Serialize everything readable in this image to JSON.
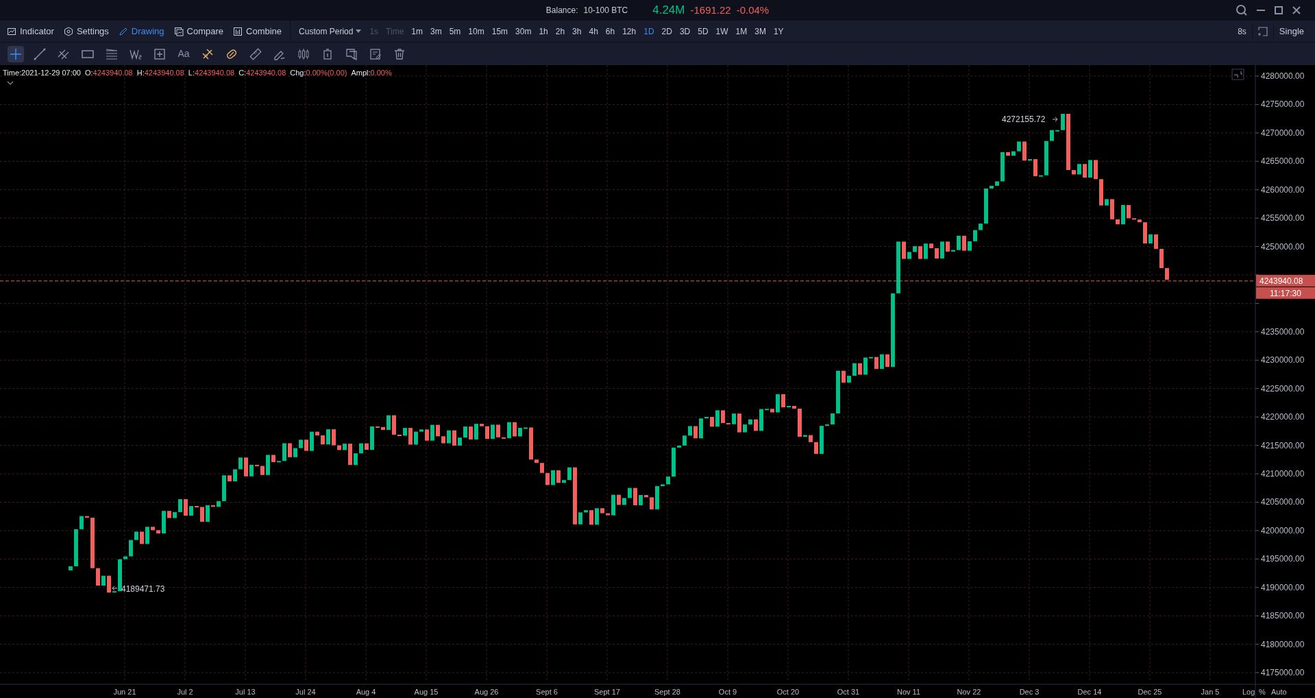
{
  "title_bar": {
    "balance_label": "Balance:",
    "balance_range": "10-100 BTC",
    "price": "4.24M",
    "change": "-1691.22",
    "change_pct": "-0.04%"
  },
  "menu": [
    {
      "label": "Indicator",
      "selected": false
    },
    {
      "label": "Settings",
      "selected": false
    },
    {
      "label": "Drawing",
      "selected": true
    },
    {
      "label": "Compare",
      "selected": false
    },
    {
      "label": "Combine",
      "selected": false
    }
  ],
  "period_dropdown": "Custom Period",
  "periods": [
    {
      "label": "1s",
      "disabled": true,
      "selected": false
    },
    {
      "label": "Time",
      "disabled": true,
      "selected": false
    },
    {
      "label": "1m",
      "disabled": false,
      "selected": false
    },
    {
      "label": "3m",
      "disabled": false,
      "selected": false
    },
    {
      "label": "5m",
      "disabled": false,
      "selected": false
    },
    {
      "label": "10m",
      "disabled": false,
      "selected": false
    },
    {
      "label": "15m",
      "disabled": false,
      "selected": false
    },
    {
      "label": "30m",
      "disabled": false,
      "selected": false
    },
    {
      "label": "1h",
      "disabled": false,
      "selected": false
    },
    {
      "label": "2h",
      "disabled": false,
      "selected": false
    },
    {
      "label": "3h",
      "disabled": false,
      "selected": false
    },
    {
      "label": "4h",
      "disabled": false,
      "selected": false
    },
    {
      "label": "6h",
      "disabled": false,
      "selected": false
    },
    {
      "label": "12h",
      "disabled": false,
      "selected": false
    },
    {
      "label": "1D",
      "disabled": false,
      "selected": true
    },
    {
      "label": "2D",
      "disabled": false,
      "selected": false
    },
    {
      "label": "3D",
      "disabled": false,
      "selected": false
    },
    {
      "label": "5D",
      "disabled": false,
      "selected": false
    },
    {
      "label": "1W",
      "disabled": false,
      "selected": false
    },
    {
      "label": "1M",
      "disabled": false,
      "selected": false
    },
    {
      "label": "3M",
      "disabled": false,
      "selected": false
    },
    {
      "label": "1Y",
      "disabled": false,
      "selected": false
    }
  ],
  "refresh": "8s",
  "layout": "Single",
  "drawing_tools": [
    {
      "selected": true
    },
    {
      "selected": false
    },
    {
      "selected": false
    },
    {
      "selected": false
    },
    {
      "selected": false
    },
    {
      "selected": false
    },
    {
      "selected": false
    },
    {
      "label": "Aa",
      "selected": false
    },
    {
      "selected": false
    },
    {
      "selected": false
    },
    {
      "selected": false
    },
    {
      "selected": false
    },
    {
      "selected": false
    },
    {
      "selected": false
    },
    {
      "selected": false
    },
    {
      "selected": false
    },
    {
      "selected": false
    }
  ],
  "info": [
    {
      "label": "Time:",
      "value": "2021-12-29 07:00",
      "kind": "time"
    },
    {
      "label": "O:",
      "value": "4243940.08",
      "kind": "price"
    },
    {
      "label": "H:",
      "value": "4243940.08",
      "kind": "price"
    },
    {
      "label": "L:",
      "value": "4243940.08",
      "kind": "price"
    },
    {
      "label": "C:",
      "value": "4243940.08",
      "kind": "price"
    },
    {
      "label": "Chg:",
      "value": "0.00%(0.00)",
      "kind": "price"
    },
    {
      "label": "Ampl:",
      "value": "0.00%",
      "kind": "price"
    }
  ],
  "chart": {
    "y_labels_upper": [
      "4280000.00",
      "4275000.00",
      "4270000.00",
      "4265000.00",
      "4260000.00",
      "4255000.00",
      "4250000.00"
    ],
    "y_labels_lower": [
      "4235000.00",
      "4230000.00",
      "4225000.00",
      "4220000.00",
      "4215000.00",
      "4210000.00",
      "4205000.00",
      "4200000.00",
      "4195000.00",
      "4190000.00",
      "4185000.00",
      "4180000.00",
      "4175000.00"
    ],
    "x_labels": [
      "Jun 21",
      "Jul 2",
      "Jul 13",
      "Jul 24",
      "Aug 4",
      "Aug 15",
      "Aug 26",
      "Sept 6",
      "Sept 17",
      "Sept 28",
      "Oct 9",
      "Oct 20",
      "Oct 31",
      "Nov 11",
      "Nov 22",
      "Dec 3",
      "Dec 14",
      "Dec 25",
      "Jan 5"
    ],
    "current_price": "4243940.08",
    "countdown": "11:17:30",
    "high_annotation": "4272155.72",
    "low_annotation": "4189471.73",
    "scale_options": [
      "Log",
      "%",
      "Auto"
    ]
  }
}
